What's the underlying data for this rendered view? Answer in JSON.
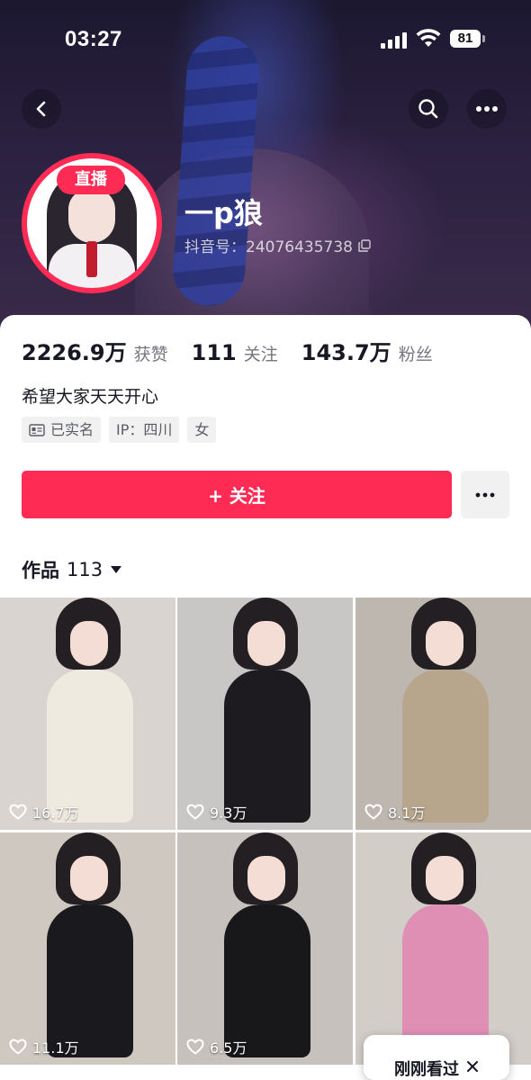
{
  "status_bar": {
    "time": "03:27",
    "battery": "81"
  },
  "profile": {
    "live_badge": "直播",
    "nickname": "一p狼",
    "douyin_id": "抖音号：24076435738",
    "stats": [
      {
        "value": "2226.9万",
        "label": "获赞"
      },
      {
        "value": "111",
        "label": "关注"
      },
      {
        "value": "143.7万",
        "label": "粉丝"
      }
    ],
    "bio": "希望大家天天开心",
    "tags": [
      {
        "label": "已实名",
        "icon": "id-card-icon"
      },
      {
        "label": "IP：四川"
      },
      {
        "label": "女"
      }
    ],
    "follow_button": "+ 关注"
  },
  "works": {
    "label": "作品",
    "count": "113"
  },
  "videos": [
    {
      "likes": "16.7万",
      "bg": "#d9d4cf",
      "outfit": "#eeeadf"
    },
    {
      "likes": "9.3万",
      "bg": "#c9c6c6",
      "outfit": "#1d1b1f"
    },
    {
      "likes": "8.1万",
      "bg": "#bdb7b0",
      "outfit": "#b7a58c"
    },
    {
      "likes": "11.1万",
      "bg": "#cfc8c1",
      "outfit": "#1a1a1e"
    },
    {
      "likes": "6.5万",
      "bg": "#c6c1bd",
      "outfit": "#18171a"
    },
    {
      "likes": "",
      "bg": "#d3cdc8",
      "outfit": "#df8fb3"
    }
  ],
  "floating": {
    "recent_label": "刚刚看过"
  },
  "colors": {
    "brand": "#fe2c55",
    "tag_bg": "#f1f1f2"
  }
}
